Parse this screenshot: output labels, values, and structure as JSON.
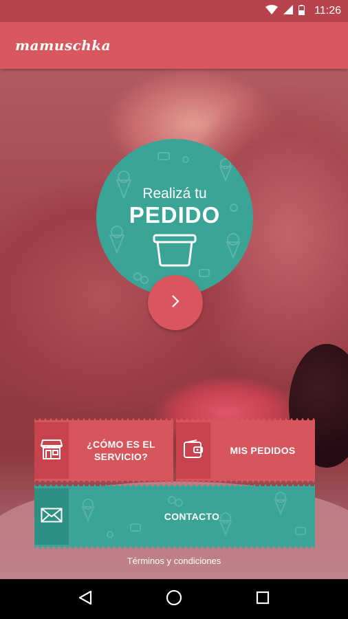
{
  "status_bar": {
    "time": "11:26",
    "icons": [
      "wifi-icon",
      "signal-icon",
      "battery-icon"
    ],
    "color": "#b9434c"
  },
  "app_bar": {
    "logo_text": "mamuschka",
    "color": "#d9575f"
  },
  "order": {
    "pre_label": "Realizá tu",
    "main_label": "PEDIDO",
    "icon": "ice-cream-tub-icon",
    "next_icon": "chevron-right-icon",
    "circle_color": "#3aa597",
    "button_color": "#d9565e"
  },
  "menu": {
    "how_it_works": {
      "label_line1": "¿CÓMO ES EL",
      "label_line2": "SERVICIO?",
      "icon": "storefront-icon"
    },
    "my_orders": {
      "label": "MIS PEDIDOS",
      "icon": "wallet-icon"
    },
    "contact": {
      "label": "CONTACTO",
      "icon": "envelope-icon"
    }
  },
  "footer": {
    "terms_label": "Términos y condiciones"
  },
  "nav_bar": {
    "buttons": [
      "back-icon",
      "home-icon",
      "recents-icon"
    ]
  }
}
